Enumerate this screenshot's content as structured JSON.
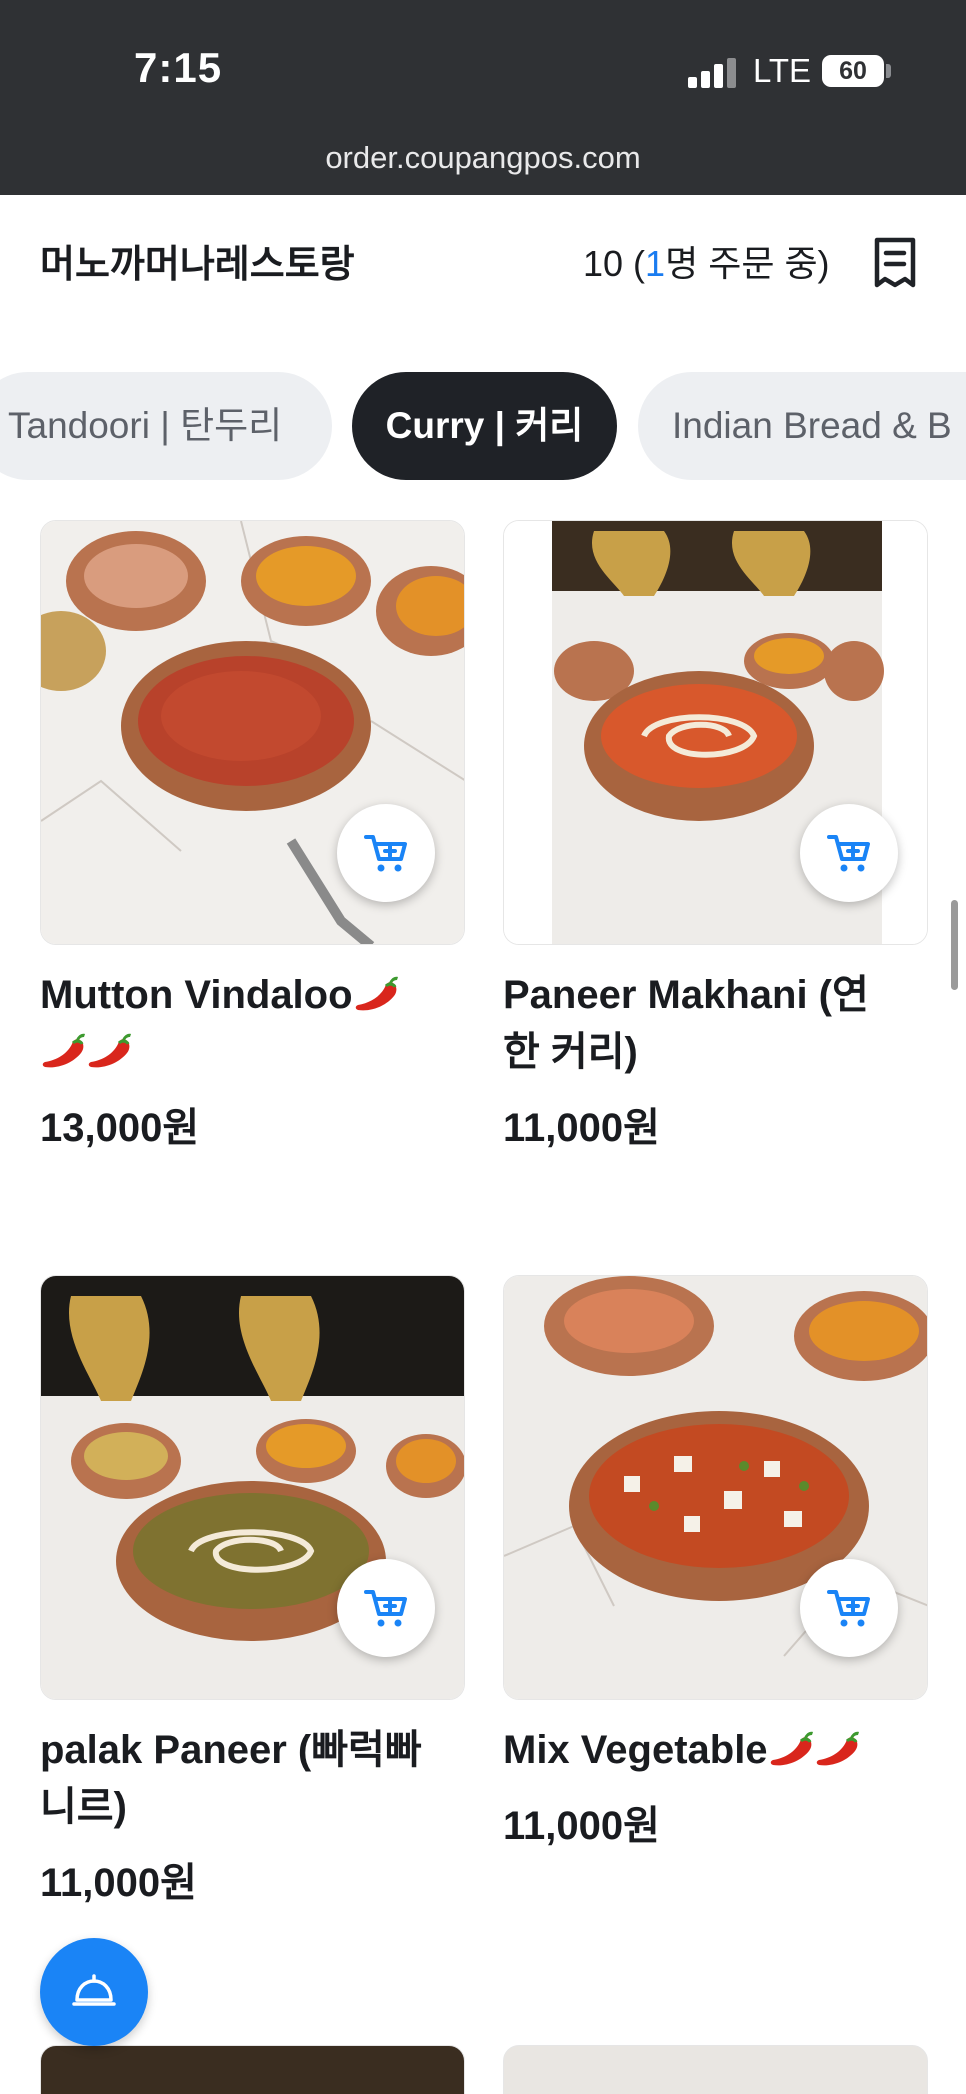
{
  "status_bar": {
    "time": "7:15",
    "network": "LTE",
    "battery": "60"
  },
  "browser": {
    "url": "order.coupangpos.com"
  },
  "header": {
    "store_name": "머노까머나레스토랑",
    "table_prefix": "10 (",
    "orderers_count": "1",
    "table_suffix": "명 주문 중)"
  },
  "categories": [
    {
      "label": "Tandoori | 탄두리",
      "active": false
    },
    {
      "label": "Curry | 커리",
      "active": true
    },
    {
      "label": "Indian Bread & B",
      "active": false
    }
  ],
  "products": [
    {
      "name": "Mutton Vindaloo",
      "line2": "",
      "chilis": 3,
      "price": "13,000원"
    },
    {
      "name": "Paneer Makhani (연",
      "line2": "한 커리)",
      "chilis": 0,
      "price": "11,000원"
    },
    {
      "name": "palak Paneer (빠럭빠",
      "line2": "니르)",
      "chilis": 0,
      "price": "11,000원"
    },
    {
      "name": "Mix Vegetable",
      "line2": "",
      "chilis": 2,
      "price": "11,000원"
    }
  ],
  "colors": {
    "accent": "#1a84f6",
    "active_tab": "#1f2227",
    "topbar": "#2f3134"
  },
  "icons": {
    "cart": "cart-add-icon",
    "receipt": "receipt-icon",
    "staff_call": "bell-icon"
  }
}
